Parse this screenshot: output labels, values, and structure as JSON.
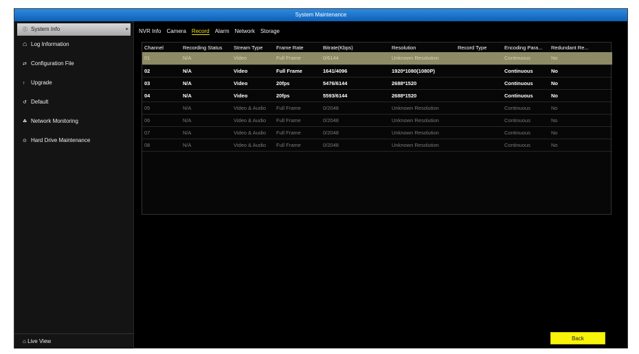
{
  "window": {
    "title": "System Maintenance"
  },
  "sidebar": {
    "items": [
      {
        "label": "System Info",
        "icon": "info-icon",
        "glyph": "ⓘ",
        "active": true
      },
      {
        "label": "Log Information",
        "icon": "log-icon",
        "glyph": "☖"
      },
      {
        "label": "Configuration File",
        "icon": "config-file-icon",
        "glyph": "⇄"
      },
      {
        "label": "Upgrade",
        "icon": "upgrade-icon",
        "glyph": "↑"
      },
      {
        "label": "Default",
        "icon": "default-icon",
        "glyph": "↺"
      },
      {
        "label": "Network Monitoring",
        "icon": "network-icon",
        "glyph": "☘"
      },
      {
        "label": "Hard Drive Maintenance",
        "icon": "hard-drive-icon",
        "glyph": "⊙"
      }
    ],
    "footer": {
      "label": "Live View",
      "icon": "home-icon",
      "glyph": "⌂"
    }
  },
  "tabs": [
    "NVR Info",
    "Camera",
    "Record",
    "Alarm",
    "Network",
    "Storage"
  ],
  "active_tab": "Record",
  "table": {
    "headers": [
      "Channel",
      "Recording Status",
      "Stream Type",
      "Frame Rate",
      "Bitrate(Kbps)",
      "Resolution",
      "Record Type",
      "Encoding Para...",
      "Redundant Re..."
    ],
    "rows": [
      {
        "cells": [
          "01",
          "N/A",
          "Video",
          "Full Frame",
          "0/6144",
          "Unknown Resolution",
          "",
          "Continuous",
          "No"
        ],
        "state": "selected"
      },
      {
        "cells": [
          "02",
          "N/A",
          "Video",
          "Full Frame",
          "1641/4096",
          "1920*1080(1080P)",
          "",
          "Continuous",
          "No"
        ],
        "state": "active"
      },
      {
        "cells": [
          "03",
          "N/A",
          "Video",
          "20fps",
          "5476/6144",
          "2688*1520",
          "",
          "Continuous",
          "No"
        ],
        "state": "active"
      },
      {
        "cells": [
          "04",
          "N/A",
          "Video",
          "20fps",
          "5593/6144",
          "2688*1520",
          "",
          "Continuous",
          "No"
        ],
        "state": "active"
      },
      {
        "cells": [
          "05",
          "N/A",
          "Video & Audio",
          "Full Frame",
          "0/2048",
          "Unknown Resolution",
          "",
          "Continuous",
          "No"
        ],
        "state": "inactive"
      },
      {
        "cells": [
          "06",
          "N/A",
          "Video & Audio",
          "Full Frame",
          "0/2048",
          "Unknown Resolution",
          "",
          "Continuous",
          "No"
        ],
        "state": "inactive"
      },
      {
        "cells": [
          "07",
          "N/A",
          "Video & Audio",
          "Full Frame",
          "0/2048",
          "Unknown Resolution",
          "",
          "Continuous",
          "No"
        ],
        "state": "inactive"
      },
      {
        "cells": [
          "08",
          "N/A",
          "Video & Audio",
          "Full Frame",
          "0/2048",
          "Unknown Resolution",
          "",
          "Continuous",
          "No"
        ],
        "state": "inactive"
      }
    ]
  },
  "buttons": {
    "back": "Back"
  },
  "colors": {
    "titlebar": "#1a74cc",
    "accent": "#f7f40a",
    "selected_row": "#8d8a66"
  }
}
